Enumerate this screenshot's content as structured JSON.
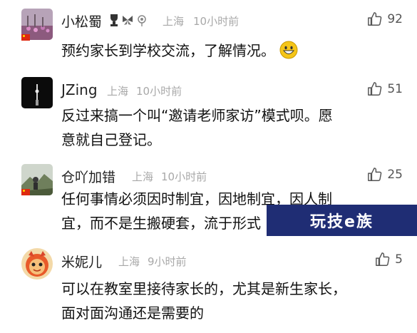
{
  "comments": [
    {
      "user": "小松蜀",
      "location": "上海",
      "time": "10小时前",
      "likes": "92",
      "text": "预约家长到学校交流，了解情况。",
      "emoji": "grin-emoji"
    },
    {
      "user": "JZing",
      "location": "上海",
      "time": "10小时前",
      "likes": "51",
      "text_lines": [
        "反过来搞一个叫“邀请老师家访”模式呗。愿",
        "意就自己登记。"
      ]
    },
    {
      "user": "仓吖加错",
      "location": "上海",
      "time": "10小时前",
      "likes": "25",
      "text_lines": [
        "任何事情必须因时制宜，因地制宜，因人制",
        "宜，而不是生搬硬套，流于形式"
      ]
    },
    {
      "user": "米妮儿",
      "location": "上海",
      "time": "9小时前",
      "likes": "5",
      "text_lines": [
        "可以在教室里接待家长的，尤其是新生家长，",
        "面对面沟通还是需要的"
      ]
    }
  ],
  "watermark": "玩技e族",
  "colors": {
    "meta": "#a8a8a8",
    "watermark_bg": "#1f2d74"
  }
}
